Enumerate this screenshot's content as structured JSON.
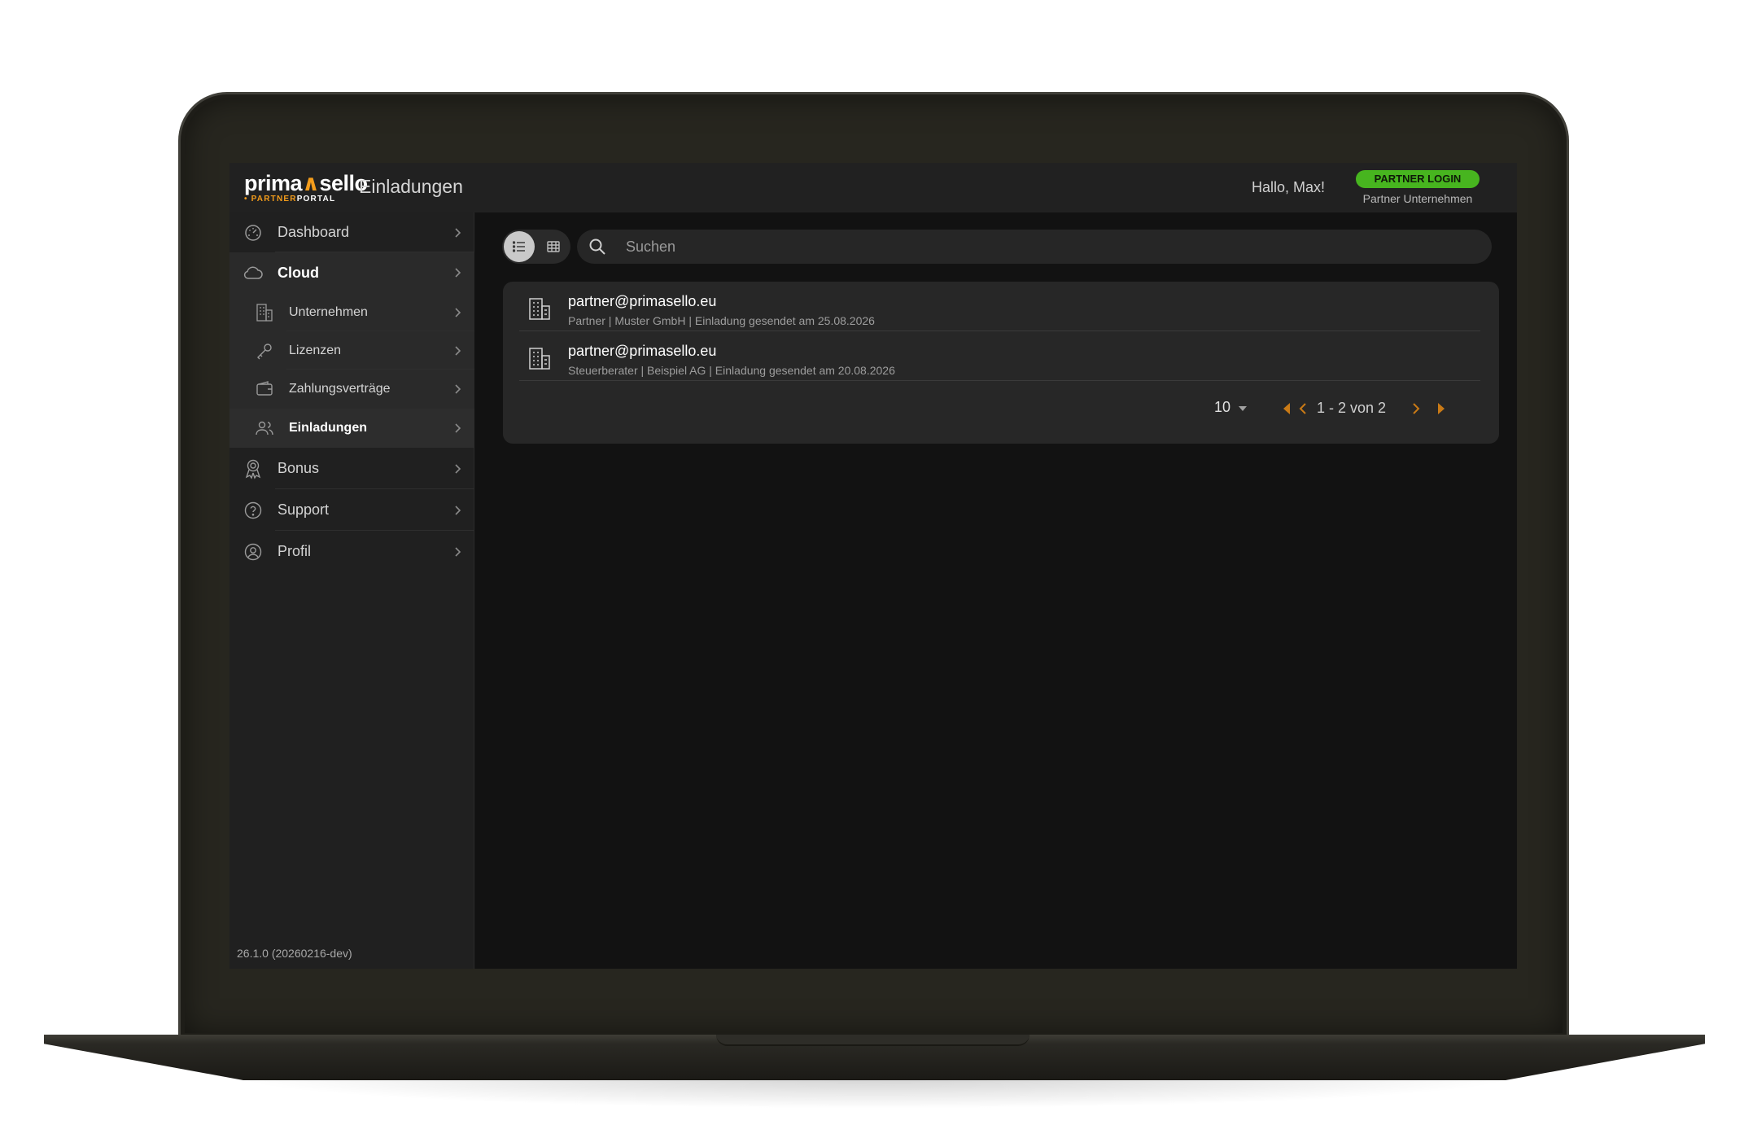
{
  "app": {
    "logo_main_a": "prima",
    "logo_main_accent": "∧",
    "logo_main_b": "sello",
    "logo_sub_accent": "• PARTNER",
    "logo_sub_b": "PORTAL",
    "page_title": "Einladungen",
    "greeting": "Hallo, Max!",
    "partner_badge": "PARTNER LOGIN",
    "partner_company": "Partner Unternehmen"
  },
  "sidebar": {
    "items": [
      {
        "label": "Dashboard",
        "icon": "speedometer-icon"
      },
      {
        "label": "Cloud",
        "icon": "cloud-icon"
      },
      {
        "label": "Unternehmen",
        "icon": "building-icon"
      },
      {
        "label": "Lizenzen",
        "icon": "key-icon"
      },
      {
        "label": "Zahlungsverträge",
        "icon": "wallet-icon"
      },
      {
        "label": "Einladungen",
        "icon": "users-icon"
      },
      {
        "label": "Bonus",
        "icon": "award-icon"
      },
      {
        "label": "Support",
        "icon": "help-circle-icon"
      },
      {
        "label": "Profil",
        "icon": "user-circle-icon"
      }
    ],
    "version": "26.1.0 (20260216-dev)"
  },
  "toolbar": {
    "view_mode": "list",
    "search_placeholder": "Suchen",
    "search_value": ""
  },
  "invitations": [
    {
      "email": "partner@primasello.eu",
      "meta": "Partner | Muster GmbH | Einladung gesendet am 25.08.2026"
    },
    {
      "email": "partner@primasello.eu",
      "meta": "Steuerberater | Beispiel AG | Einladung gesendet am 20.08.2026"
    }
  ],
  "pagination": {
    "page_size": "10",
    "range": "1 - 2 von 2"
  },
  "colors": {
    "accent": "#f39c1b",
    "badge": "#47b51f",
    "pager_arrows": "#c97a16"
  }
}
